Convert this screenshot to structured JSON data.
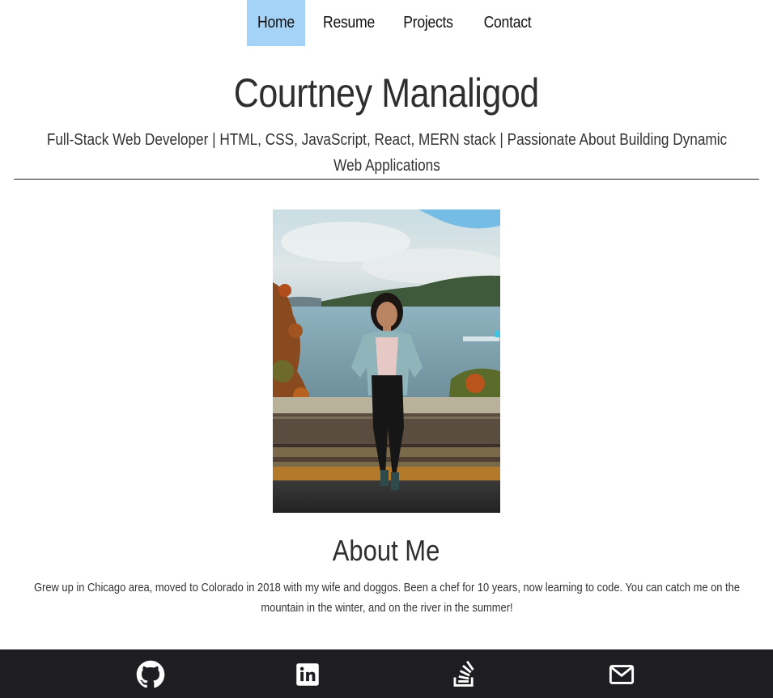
{
  "nav": {
    "items": [
      {
        "label": "Home",
        "active": true
      },
      {
        "label": "Resume",
        "active": false
      },
      {
        "label": "Projects",
        "active": false
      },
      {
        "label": "Contact",
        "active": false
      }
    ],
    "active_color": "#a5d3f7"
  },
  "header": {
    "name": "Courtney Manaligod",
    "tagline": "Full-Stack Web Developer | HTML, CSS, JavaScript, React, MERN stack | Passionate About Building Dynamic Web Applications"
  },
  "photo": {
    "subject": "portrait-by-lake"
  },
  "about": {
    "title": "About Me",
    "text": "Grew up in Chicago area, moved to Colorado in 2018 with my wife and doggos. Been a chef for 10 years, now learning to code. You can catch me on the mountain in the winter, and on the river in the summer!"
  },
  "footer": {
    "background": "#1e1d22",
    "icons": [
      "github-icon",
      "linkedin-icon",
      "stack-overflow-icon",
      "mail-icon"
    ]
  }
}
